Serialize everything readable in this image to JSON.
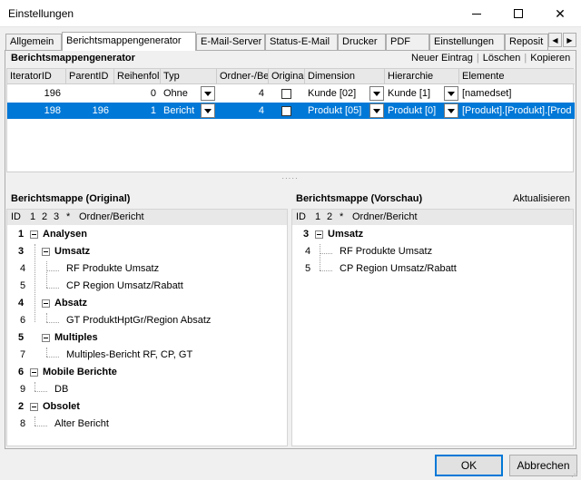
{
  "window": {
    "title": "Einstellungen"
  },
  "tabs": [
    {
      "label": "Allgemein",
      "active": false
    },
    {
      "label": "Berichtsmappengenerator",
      "active": true
    },
    {
      "label": "E-Mail-Server",
      "active": false
    },
    {
      "label": "Status-E-Mail",
      "active": false
    },
    {
      "label": "Drucker",
      "active": false
    },
    {
      "label": "PDF",
      "active": false
    },
    {
      "label": "Einstellungen",
      "active": false
    },
    {
      "label": "Reposit",
      "active": false
    }
  ],
  "generator": {
    "title": "Berichtsmappengenerator",
    "links": {
      "new": "Neuer Eintrag",
      "delete": "Löschen",
      "copy": "Kopieren"
    },
    "columns": [
      "IteratorID",
      "ParentID",
      "Reihenfol",
      "Typ",
      "Ordner-/Be",
      "Origina",
      "Dimension",
      "Hierarchie",
      "Elemente"
    ],
    "rows": [
      {
        "iterator_id": "196",
        "parent_id": "",
        "order": "0",
        "type": "Ohne",
        "folder": "4",
        "original": false,
        "dimension": "Kunde [02]",
        "hierarchy": "Kunde [1]",
        "elements": "[namedset]",
        "selected": false
      },
      {
        "iterator_id": "198",
        "parent_id": "196",
        "order": "1",
        "type": "Bericht",
        "folder": "4",
        "original": false,
        "dimension": "Produkt [05]",
        "hierarchy": "Produkt [0]",
        "elements": "[Produkt].[Produkt].[Prod",
        "selected": true
      }
    ]
  },
  "original": {
    "title": "Berichtsmappe (Original)",
    "header": {
      "id": "ID",
      "levels": [
        "1",
        "2",
        "3"
      ],
      "star": "*",
      "name": "Ordner/Bericht"
    },
    "rows": [
      {
        "id": "1",
        "label": "Analysen",
        "bold": true,
        "level": 0,
        "folder": true
      },
      {
        "id": "3",
        "label": "Umsatz",
        "bold": true,
        "level": 1,
        "folder": true
      },
      {
        "id": "4",
        "label": "RF Produkte Umsatz",
        "bold": false,
        "level": 2,
        "folder": false
      },
      {
        "id": "5",
        "label": "CP Region Umsatz/Rabatt",
        "bold": false,
        "level": 2,
        "folder": false
      },
      {
        "id": "4",
        "label": "Absatz",
        "bold": true,
        "level": 1,
        "folder": true
      },
      {
        "id": "6",
        "label": "GT ProduktHptGr/Region Absatz",
        "bold": false,
        "level": 2,
        "folder": false
      },
      {
        "id": "5",
        "label": "Multiples",
        "bold": true,
        "level": 1,
        "folder": true
      },
      {
        "id": "7",
        "label": "Multiples-Bericht RF, CP, GT",
        "bold": false,
        "level": 2,
        "folder": false
      },
      {
        "id": "6",
        "label": "Mobile Berichte",
        "bold": true,
        "level": 0,
        "folder": true
      },
      {
        "id": "9",
        "label": "DB",
        "bold": false,
        "level": 1,
        "folder": false
      },
      {
        "id": "2",
        "label": "Obsolet",
        "bold": true,
        "level": 0,
        "folder": true
      },
      {
        "id": "8",
        "label": "Alter Bericht",
        "bold": false,
        "level": 1,
        "folder": false
      }
    ]
  },
  "preview": {
    "title": "Berichtsmappe (Vorschau)",
    "refresh": "Aktualisieren",
    "header": {
      "id": "ID",
      "levels": [
        "1",
        "2"
      ],
      "star": "*",
      "name": "Ordner/Bericht"
    },
    "rows": [
      {
        "id": "3",
        "label": "Umsatz",
        "bold": true,
        "level": 0,
        "folder": true
      },
      {
        "id": "4",
        "label": "RF Produkte Umsatz",
        "bold": false,
        "level": 1,
        "folder": false
      },
      {
        "id": "5",
        "label": "CP Region Umsatz/Rabatt",
        "bold": false,
        "level": 1,
        "folder": false
      }
    ]
  },
  "buttons": {
    "ok": "OK",
    "cancel": "Abbrechen"
  },
  "colors": {
    "selection": "#0078d7",
    "accent": "#0078d7"
  }
}
